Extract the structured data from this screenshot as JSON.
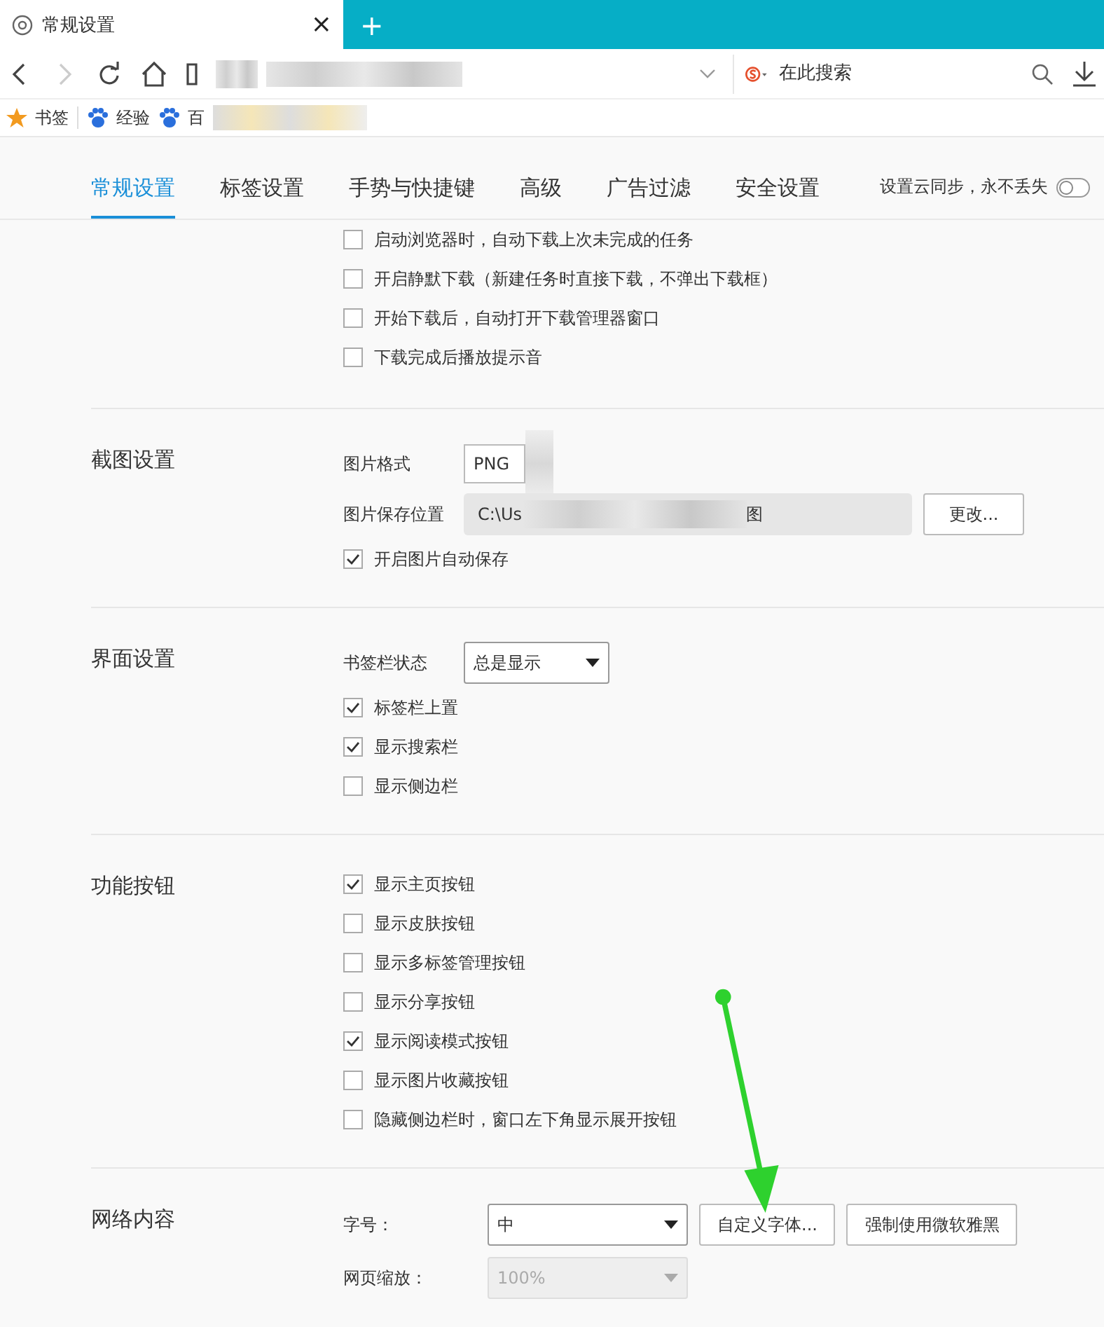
{
  "browser_tab": {
    "title": "常规设置",
    "close": "×"
  },
  "new_tab": "+",
  "search": {
    "placeholder": "在此搜索"
  },
  "bookmarks": [
    {
      "label": "书签",
      "kind": "star"
    },
    {
      "label": "经验",
      "kind": "paw"
    },
    {
      "label": "百",
      "kind": "paw"
    }
  ],
  "settings_tabs": [
    {
      "label": "常规设置",
      "selected": true
    },
    {
      "label": "标签设置",
      "selected": false
    },
    {
      "label": "手势与快捷键",
      "selected": false
    },
    {
      "label": "高级",
      "selected": false
    },
    {
      "label": "广告过滤",
      "selected": false
    },
    {
      "label": "安全设置",
      "selected": false
    }
  ],
  "cloud_sync": {
    "label": "设置云同步，永不丢失",
    "on": false
  },
  "sections": [
    {
      "items": [
        {
          "kind": "checkbox",
          "label": "启动浏览器时，自动下载上次未完成的任务",
          "checked": false
        },
        {
          "kind": "checkbox",
          "label": "开启静默下载（新建任务时直接下载，不弹出下载框）",
          "checked": false
        },
        {
          "kind": "checkbox",
          "label": "开始下载后，自动打开下载管理器窗口",
          "checked": false
        },
        {
          "kind": "checkbox",
          "label": "下载完成后播放提示音",
          "checked": false
        }
      ]
    },
    {
      "title": "截图设置",
      "items": [
        {
          "kind": "format",
          "label": "图片格式",
          "value": "PNG"
        },
        {
          "kind": "path",
          "label": "图片保存位置",
          "value_start": "C:\\Us",
          "value_end": "图",
          "button": "更改..."
        },
        {
          "kind": "checkbox",
          "label": "开启图片自动保存",
          "checked": true
        }
      ]
    },
    {
      "title": "界面设置",
      "items": [
        {
          "kind": "select",
          "label": "书签栏状态",
          "value": "总是显示",
          "disabled": false
        },
        {
          "kind": "checkbox",
          "label": "标签栏上置",
          "checked": true
        },
        {
          "kind": "checkbox",
          "label": "显示搜索栏",
          "checked": true
        },
        {
          "kind": "checkbox",
          "label": "显示侧边栏",
          "checked": false
        }
      ]
    },
    {
      "title": "功能按钮",
      "items": [
        {
          "kind": "checkbox",
          "label": "显示主页按钮",
          "checked": true
        },
        {
          "kind": "checkbox",
          "label": "显示皮肤按钮",
          "checked": false
        },
        {
          "kind": "checkbox",
          "label": "显示多标签管理按钮",
          "checked": false
        },
        {
          "kind": "checkbox",
          "label": "显示分享按钮",
          "checked": false
        },
        {
          "kind": "checkbox",
          "label": "显示阅读模式按钮",
          "checked": true
        },
        {
          "kind": "checkbox",
          "label": "显示图片收藏按钮",
          "checked": false
        },
        {
          "kind": "checkbox",
          "label": "隐藏侧边栏时，窗口左下角显示展开按钮",
          "checked": false
        }
      ]
    },
    {
      "title": "网络内容",
      "items": [
        {
          "kind": "wide-select",
          "label": "字号：",
          "value": "中",
          "disabled": false,
          "buttons": [
            "自定义字体...",
            "强制使用微软雅黑"
          ]
        },
        {
          "kind": "wide-select",
          "label": "网页缩放：",
          "value": "100%",
          "disabled": true
        }
      ]
    }
  ]
}
